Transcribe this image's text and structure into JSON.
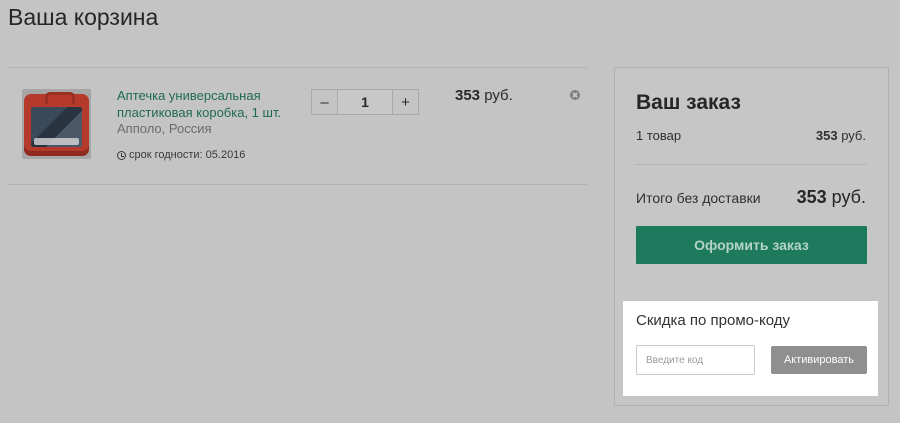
{
  "page": {
    "title": "Ваша корзина"
  },
  "cart": {
    "items": [
      {
        "name": "Аптечка универсальная пластиковая коробка, 1 шт.",
        "vendor": "Апполо, Россия",
        "expiry": "срок годности: 05.2016",
        "quantity": "1",
        "qty_minus": "–",
        "qty_plus": "+",
        "price_amount": "353",
        "price_currency": "руб.",
        "image_icon": "first-aid-kit-image",
        "remove_icon": "close-circle-icon"
      }
    ]
  },
  "order": {
    "title": "Ваш заказ",
    "count_label": "1 товар",
    "count_price_amount": "353",
    "count_price_currency": "руб.",
    "total_label": "Итого без доставки",
    "total_amount": "353",
    "total_currency": "руб.",
    "checkout_label": "Оформить заказ"
  },
  "promo": {
    "title": "Скидка по промо-коду",
    "input_value": "",
    "input_placeholder": "Введите код",
    "button_label": "Активировать"
  },
  "colors": {
    "overlay_gray": "#c4c4c4",
    "accent_green": "#1d7a5d",
    "link_green": "#1f6a53",
    "promo_button": "#8f8f8f"
  }
}
